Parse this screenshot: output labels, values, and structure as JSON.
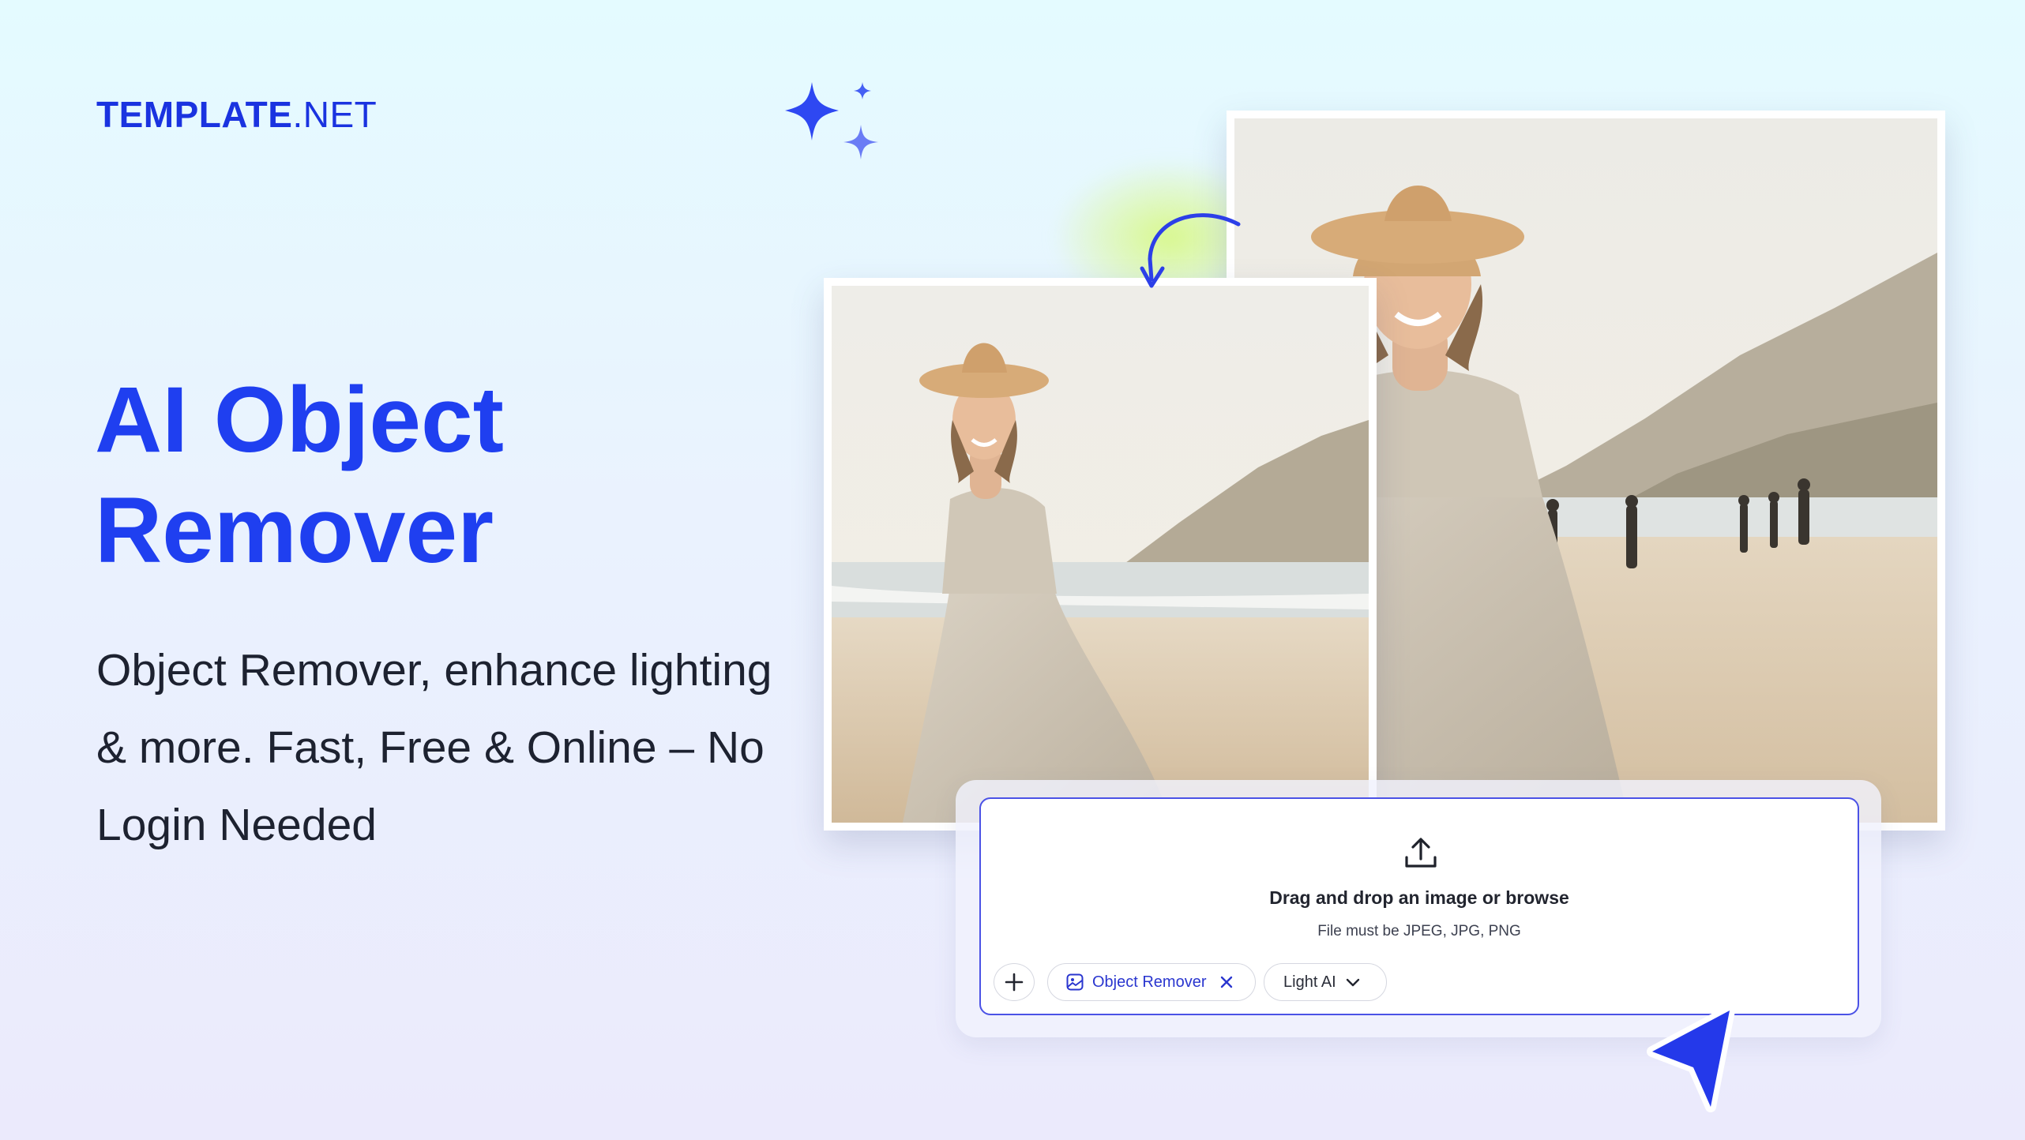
{
  "brand": {
    "name": "TEMPLATE",
    "suffix": ".NET"
  },
  "hero": {
    "title": "AI Object Remover",
    "subtitle": "Object Remover, enhance lighting & more. Fast, Free & Online – No Login Needed"
  },
  "upload": {
    "icon": "upload-icon",
    "title": "Drag and drop an image or browse",
    "hint": "File must be JPEG, JPG, PNG"
  },
  "toolbar": {
    "add_icon": "plus-icon",
    "chip_remover": {
      "label": "Object Remover",
      "icon": "image-icon",
      "close_icon": "close-icon"
    },
    "chip_light": {
      "label": "Light AI",
      "icon": "chevron-down-icon"
    }
  },
  "colors": {
    "brand_blue": "#1f3ff0",
    "accent_blue": "#4b52e6",
    "text_dark": "#1d2230"
  }
}
